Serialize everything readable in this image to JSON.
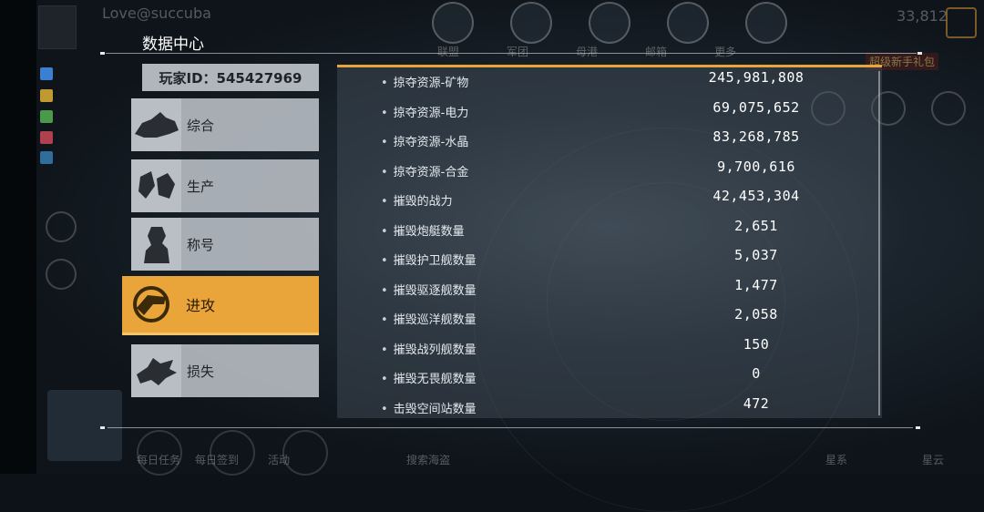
{
  "header": {
    "title": "数据中心",
    "player_id_label": "玩家ID：545427969"
  },
  "background_hud": {
    "username": "Love@succuba",
    "top_nav": [
      "联盟",
      "军团",
      "母港",
      "邮箱",
      "更多"
    ],
    "currency": "33,812",
    "gift_banner": "超级新手礼包",
    "bottom_labels": [
      "每日任务",
      "每日签到",
      "活动",
      "搜索海盗",
      "星系",
      "星云"
    ]
  },
  "tabs": [
    {
      "label": "综合",
      "icon": "ship-icon",
      "active": false
    },
    {
      "label": "生产",
      "icon": "crystal-icon",
      "active": false
    },
    {
      "label": "称号",
      "icon": "commander-silhouette-icon",
      "active": false
    },
    {
      "label": "进攻",
      "icon": "attack-emblem-icon",
      "active": true
    },
    {
      "label": "损失",
      "icon": "wreck-icon",
      "active": false
    }
  ],
  "stats": [
    {
      "label": "掠夺资源-矿物",
      "value": "245,981,808"
    },
    {
      "label": "掠夺资源-电力",
      "value": "69,075,652"
    },
    {
      "label": "掠夺资源-水晶",
      "value": "83,268,785"
    },
    {
      "label": "掠夺资源-合金",
      "value": "9,700,616"
    },
    {
      "label": "摧毁的战力",
      "value": "42,453,304"
    },
    {
      "label": "摧毁炮艇数量",
      "value": "2,651"
    },
    {
      "label": "摧毁护卫舰数量",
      "value": "5,037"
    },
    {
      "label": "摧毁驱逐舰数量",
      "value": "1,477"
    },
    {
      "label": "摧毁巡洋舰数量",
      "value": "2,058"
    },
    {
      "label": "摧毁战列舰数量",
      "value": "150"
    },
    {
      "label": "摧毁无畏舰数量",
      "value": "0"
    },
    {
      "label": "击毁空间站数量",
      "value": "472"
    }
  ],
  "colors": {
    "accent": "#e9a43a",
    "tab_bg": "#b4babf",
    "panel_bg": "#46525e"
  }
}
